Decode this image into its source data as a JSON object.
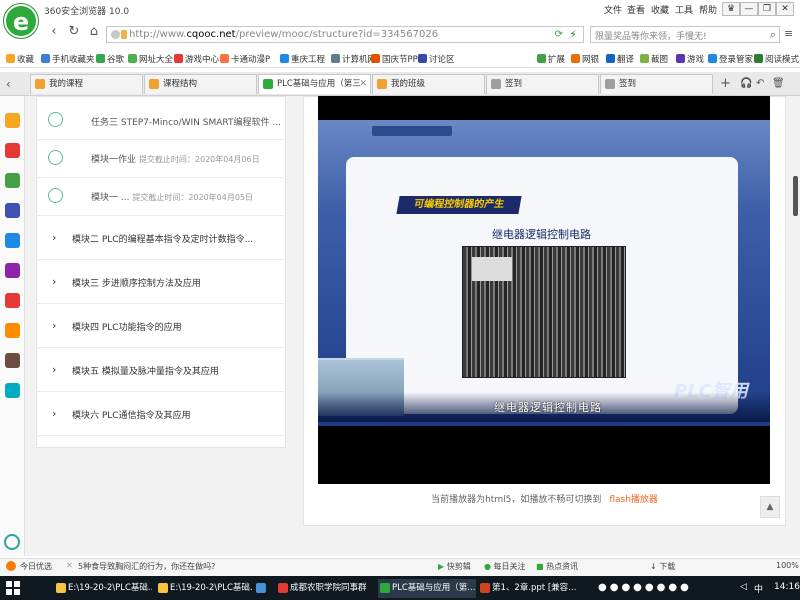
{
  "browser": {
    "app_title": "360安全浏览器 10.0",
    "menu": [
      "文件",
      "查看",
      "收藏",
      "工具",
      "帮助"
    ],
    "url_prefix": "http://www.",
    "url_domain": "cqooc.net",
    "url_path": "/preview/mooc/structure?id=334567026",
    "search_placeholder": "限量奖品等你来领，手慢无!",
    "logo_letter": "e"
  },
  "bookmarks": [
    {
      "label": "收藏",
      "color": "#f5a623"
    },
    {
      "label": "手机收藏夹",
      "color": "#3b7dd8"
    },
    {
      "label": "谷歌",
      "color": "#34a853"
    },
    {
      "label": "网址大全",
      "color": "#4caf50"
    },
    {
      "label": "游戏中心",
      "color": "#e53935"
    },
    {
      "label": "卡通动漫P",
      "color": "#ff7043"
    },
    {
      "label": "重庆工程",
      "color": "#1e88e5"
    },
    {
      "label": "计算机网",
      "color": "#607d8b"
    },
    {
      "label": "国庆节PP",
      "color": "#e65100"
    },
    {
      "label": "讨论区",
      "color": "#3949ab"
    }
  ],
  "bookmarks_right": [
    "扩展",
    "网银",
    "翻译",
    "截图",
    "游戏",
    "登录管家",
    "阅读模式"
  ],
  "tabs": [
    {
      "label": "我的课程",
      "color": "#f0a030",
      "active": false
    },
    {
      "label": "课程结构",
      "color": "#f0a030",
      "active": false
    },
    {
      "label": "PLC基础与应用（第三",
      "color": "#2eaa3c",
      "active": true
    },
    {
      "label": "我的班级",
      "color": "#f0a030",
      "active": false
    },
    {
      "label": "签到",
      "color": "#9e9e9e",
      "active": false
    },
    {
      "label": "签到",
      "color": "#9e9e9e",
      "active": false
    }
  ],
  "sidebar_icons": [
    {
      "name": "star-icon",
      "color": "#f5a623"
    },
    {
      "name": "weibo-icon",
      "color": "#e53935"
    },
    {
      "name": "mail-icon",
      "color": "#43a047"
    },
    {
      "name": "app-icon-1",
      "color": "#3f51b5"
    },
    {
      "name": "app-icon-2",
      "color": "#1e88e5"
    },
    {
      "name": "game-icon-1",
      "color": "#8e24aa"
    },
    {
      "name": "shop-icon",
      "color": "#e53935"
    },
    {
      "name": "game-icon-2",
      "color": "#fb8c00"
    },
    {
      "name": "game-icon-3",
      "color": "#6d4c41"
    },
    {
      "name": "p-icon",
      "color": "#00acc1"
    }
  ],
  "tasks": [
    {
      "title": "任务三 STEP7-Minco/WIN SMART编程软件 ...",
      "deadline": ""
    },
    {
      "title": "模块一作业",
      "deadline": "提交截止时间：2020年04月06日"
    },
    {
      "title": "模块一 ...",
      "deadline": "提交截止时间：2020年04月05日"
    }
  ],
  "modules": [
    "模块二 PLC的编程基本指令及定时计数指令...",
    "模块三 步进顺序控制方法及应用",
    "模块四 PLC功能指令的应用",
    "模块五 模拟量及脉冲量指令及其应用",
    "模块六 PLC通信指令及其应用"
  ],
  "slide": {
    "banner": "可编程控制器的产生",
    "heading": "继电器逻辑控制电路",
    "caption": "继电器逻辑控制电路",
    "watermark": "PLC智用"
  },
  "player": {
    "note": "当前播放器为html5，如播放不畅可切换到",
    "switch_link": "flash播放器",
    "scroll_up": "▲"
  },
  "statusbar": {
    "left1": "今日优选",
    "left2": "5种食导致胸闷汇的行为，你还在做吗?",
    "right": [
      "快剪辑",
      "每日关注",
      "热点资讯",
      "下载",
      "100%"
    ]
  },
  "taskbar": {
    "items": [
      {
        "label": "E:\\19-20-2\\PLC基础...",
        "color": "#f5c542",
        "active": false
      },
      {
        "label": "E:\\19-20-2\\PLC基础...",
        "color": "#f5c542",
        "active": false
      },
      {
        "label": "",
        "color": "#4a90d9",
        "active": false
      },
      {
        "label": "成都农职学院同事群",
        "color": "#e53935",
        "active": false
      },
      {
        "label": "PLC基础与应用（第...",
        "color": "#2eaa3c",
        "active": true
      },
      {
        "label": "第1、2章.ppt [兼容...",
        "color": "#d04423",
        "active": false
      }
    ],
    "ime": "中",
    "clock": "14:16"
  }
}
